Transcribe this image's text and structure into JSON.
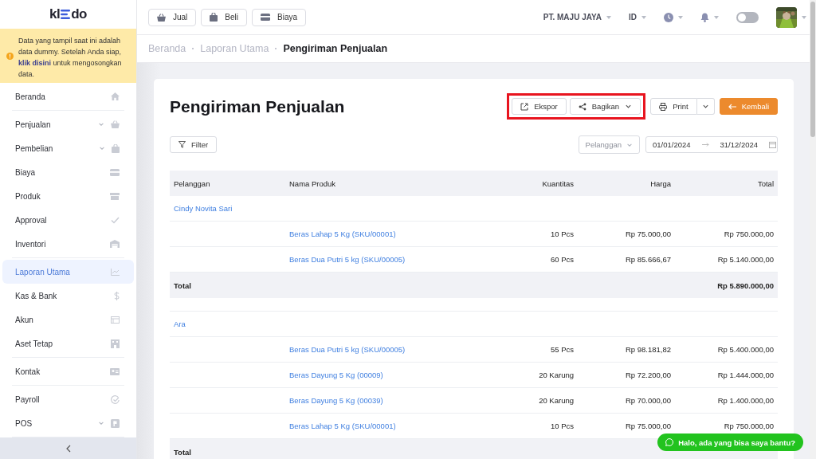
{
  "sidebar": {
    "logo": {
      "left": "kl",
      "right": "do"
    },
    "notice": {
      "before": "Data yang tampil saat ini adalah data dummy. Setelah Anda siap, ",
      "link": "klik disini",
      "after": " untuk mengosongkan data."
    },
    "sections": [
      {
        "items": [
          {
            "label": "Beranda",
            "selected": false,
            "expandable": false
          }
        ]
      },
      {
        "items": [
          {
            "label": "Penjualan",
            "selected": false,
            "expandable": true
          },
          {
            "label": "Pembelian",
            "selected": false,
            "expandable": true
          },
          {
            "label": "Biaya",
            "selected": false,
            "expandable": false
          },
          {
            "label": "Produk",
            "selected": false,
            "expandable": false
          },
          {
            "label": "Approval",
            "selected": false,
            "expandable": false
          },
          {
            "label": "Inventori",
            "selected": false,
            "expandable": false
          }
        ]
      },
      {
        "items": [
          {
            "label": "Laporan Utama",
            "selected": true,
            "expandable": false
          },
          {
            "label": "Kas & Bank",
            "selected": false,
            "expandable": false
          },
          {
            "label": "Akun",
            "selected": false,
            "expandable": false
          },
          {
            "label": "Aset Tetap",
            "selected": false,
            "expandable": false
          }
        ]
      },
      {
        "items": [
          {
            "label": "Kontak",
            "selected": false,
            "expandable": false
          }
        ]
      },
      {
        "items": [
          {
            "label": "Payroll",
            "selected": false,
            "expandable": false
          },
          {
            "label": "POS",
            "selected": false,
            "expandable": true
          }
        ]
      }
    ]
  },
  "topbar": {
    "quick_buttons": [
      "Jual",
      "Beli",
      "Biaya"
    ],
    "company": "PT. MAJU JAYA",
    "language": "ID",
    "dark_mode": false
  },
  "breadcrumb": [
    {
      "label": "Beranda",
      "current": false
    },
    {
      "label": "Laporan Utama",
      "current": false
    },
    {
      "label": "Pengiriman Penjualan",
      "current": true
    }
  ],
  "report": {
    "title": "Pengiriman Penjualan",
    "actions": [
      {
        "label": "Ekspor",
        "kind": "export",
        "highlighted": true
      },
      {
        "label": "Bagikan",
        "kind": "share",
        "highlighted": true
      },
      {
        "label": "Print",
        "kind": "print",
        "highlighted": false
      },
      {
        "label": "Kembali",
        "kind": "back",
        "highlighted": false
      }
    ],
    "filter": "Filter",
    "customer_select": {
      "placeholder": "Pelanggan"
    },
    "date_range": {
      "start": "01/01/2024",
      "end": "31/12/2024"
    },
    "table": {
      "columns": [
        "Pelanggan",
        "Nama Produk",
        "Kuantitas",
        "Harga",
        "Total"
      ],
      "groups": [
        {
          "customer": "Cindy Novita Sari",
          "items": [
            {
              "product": "Beras Lahap 5 Kg (SKU/00001)",
              "quantity": "10 Pcs",
              "price": "Rp 75.000,00",
              "total": "Rp 750.000,00"
            },
            {
              "product": "Beras Dua Putri 5 kg (SKU/00005)",
              "quantity": "60 Pcs",
              "price": "Rp 85.666,67",
              "total": "Rp 5.140.000,00"
            }
          ],
          "total_label": "Total",
          "total": "Rp 5.890.000,00"
        },
        {
          "customer": "Ara",
          "items": [
            {
              "product": "Beras Dua Putri 5 kg (SKU/00005)",
              "quantity": "55 Pcs",
              "price": "Rp 98.181,82",
              "total": "Rp 5.400.000,00"
            },
            {
              "product": "Beras Dayung 5 Kg (00009)",
              "quantity": "20 Karung",
              "price": "Rp 72.200,00",
              "total": "Rp 1.444.000,00"
            },
            {
              "product": "Beras Dayung 5 Kg (00039)",
              "quantity": "20 Karung",
              "price": "Rp 70.000,00",
              "total": "Rp 1.400.000,00"
            },
            {
              "product": "Beras Lahap 5 Kg (SKU/00001)",
              "quantity": "10 Pcs",
              "price": "Rp 75.000,00",
              "total": "Rp 750.000,00"
            }
          ],
          "total_label": "Total"
        }
      ]
    }
  },
  "chat_button": {
    "label": "Halo, ada yang bisa saya bantu?"
  }
}
